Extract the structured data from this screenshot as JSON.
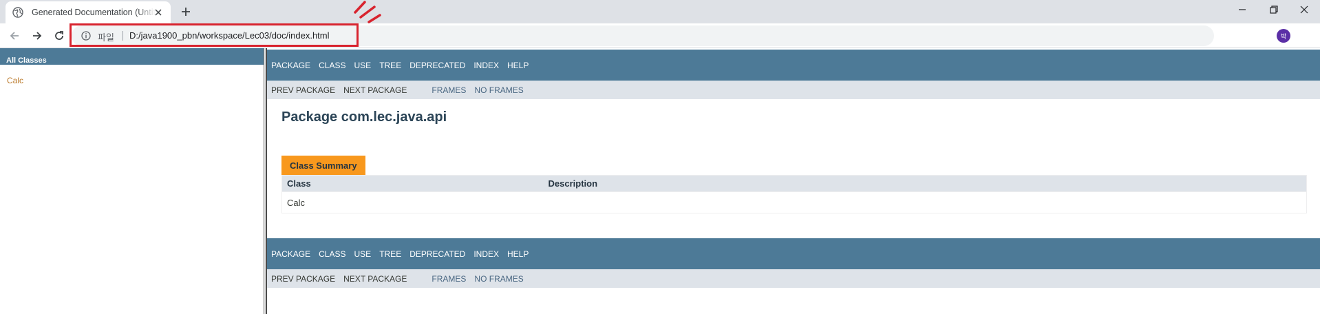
{
  "browser": {
    "tab_title": "Generated Documentation (Untitled)",
    "address_scheme": "파일",
    "address_url": "D:/java1900_pbn/workspace/Lec03/doc/index.html",
    "profile_initial": "박",
    "highlight_color": "#d8232e"
  },
  "left_frame": {
    "header": "All Classes",
    "classes": [
      "Calc"
    ]
  },
  "nav": {
    "top_items": [
      "PACKAGE",
      "CLASS",
      "USE",
      "TREE",
      "DEPRECATED",
      "INDEX",
      "HELP"
    ],
    "prev_package": "PREV PACKAGE",
    "next_package": "NEXT PACKAGE",
    "frames": "FRAMES",
    "no_frames": "NO FRAMES"
  },
  "main": {
    "title": "Package com.lec.java.api",
    "summary_caption": "Class Summary",
    "columns": [
      "Class",
      "Description"
    ],
    "rows": [
      {
        "class": "Calc",
        "description": ""
      }
    ]
  },
  "colors": {
    "nav_bar": "#4d7a97",
    "sub_nav": "#dee3e9",
    "caption": "#f8981d",
    "link": "#bb7a2a"
  }
}
